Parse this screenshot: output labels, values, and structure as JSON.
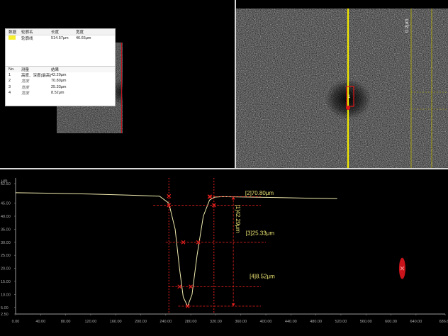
{
  "measure_panel": {
    "header": [
      "数据",
      "轮廓名",
      "长度",
      "宽度"
    ],
    "selected": {
      "name": "轮廓线",
      "length": "514.57μm",
      "width": "46.65μm"
    },
    "columns": [
      "No.",
      "测量",
      "结果"
    ],
    "rows": [
      {
        "no": "1",
        "name": "高度、深度(最高)",
        "value": "42.29μm"
      },
      {
        "no": "2",
        "name": "宽度",
        "value": "70.80μm"
      },
      {
        "no": "3",
        "name": "宽度",
        "value": "25.33μm"
      },
      {
        "no": "4",
        "name": "宽度",
        "value": "8.52μm"
      }
    ]
  },
  "image_view": {
    "line_labels": [
      "0.2μm",
      "1"
    ]
  },
  "chart_data": {
    "type": "line",
    "xlim": [
      0,
      686.6
    ],
    "ylim": [
      2.5,
      52.5
    ],
    "unit_label": "μm",
    "xticks": [
      "0.00",
      "40.00",
      "80.00",
      "120.00",
      "160.00",
      "200.00",
      "240.00",
      "280.00",
      "320.00",
      "360.00",
      "400.00",
      "440.00",
      "480.00",
      "520.00",
      "560.00",
      "600.00",
      "640.00",
      "686.60"
    ],
    "yticks": [
      "2.50",
      "5.00",
      "10.00",
      "15.00",
      "20.00",
      "25.00",
      "30.00",
      "35.00",
      "40.00",
      "45.00",
      "52.50"
    ],
    "profile": {
      "x": [
        0,
        60,
        120,
        180,
        230,
        245,
        255,
        262,
        268,
        275,
        282,
        290,
        300,
        310,
        318,
        330,
        380,
        430,
        470,
        514
      ],
      "y": [
        49.0,
        48.8,
        48.5,
        48.1,
        47.7,
        45.0,
        35.0,
        20.0,
        9.0,
        5.5,
        10.0,
        25.0,
        40.0,
        46.2,
        47.3,
        47.5,
        47.3,
        47.1,
        46.9,
        46.7
      ]
    },
    "annotations": [
      {
        "label": "[2]70.80μm",
        "value": 70.8
      },
      {
        "label": "[3]25.33μm",
        "value": 25.33
      },
      {
        "label": "[4]8.52μm",
        "value": 8.52
      },
      {
        "label": "[1]42.29μm",
        "value": 42.29
      }
    ]
  }
}
